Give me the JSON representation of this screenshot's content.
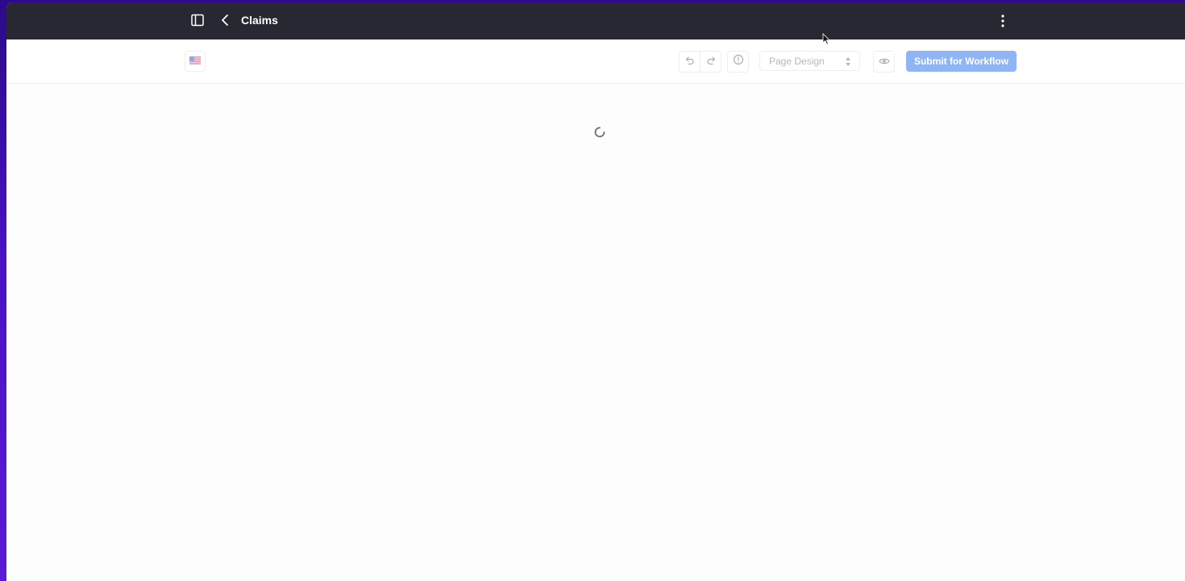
{
  "header": {
    "title": "Claims",
    "icons": {
      "sidebar_toggle": "sidebar-panel-icon",
      "back": "chevron-left-icon",
      "more": "vertical-ellipsis-icon"
    },
    "background_color": "#272832"
  },
  "toolbar": {
    "language_flag": "us-flag-icon",
    "undo_icon": "undo-icon",
    "redo_icon": "redo-icon",
    "history_icon": "clock-history-icon",
    "mode_select": {
      "selected": "Page Design"
    },
    "preview_icon": "eye-icon",
    "submit_label": "Submit for Workflow",
    "submit_color": "#8fb5f5"
  },
  "content": {
    "state": "loading",
    "spinner_icon": "loading-spinner-icon"
  }
}
